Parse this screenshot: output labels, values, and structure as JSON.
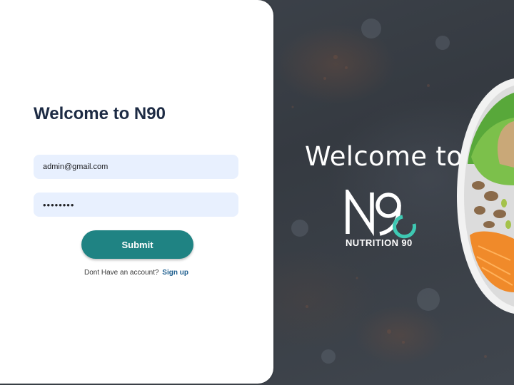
{
  "form": {
    "title": "Welcome to N90",
    "email_value": "admin@gmail.com",
    "password_value": "••••••••",
    "submit_label": "Submit",
    "signup_prompt": "Dont Have an account?",
    "signup_link": "Sign up"
  },
  "hero": {
    "title": "Welcome to",
    "logo_text": "NUTRITION 90"
  },
  "colors": {
    "primary": "#1f8383",
    "logo_accent": "#3ec9b3",
    "title": "#1d2b44",
    "field_bg": "#e8f0fe",
    "link": "#1f5f8f"
  },
  "icons": {
    "logo": "n90-logo"
  }
}
